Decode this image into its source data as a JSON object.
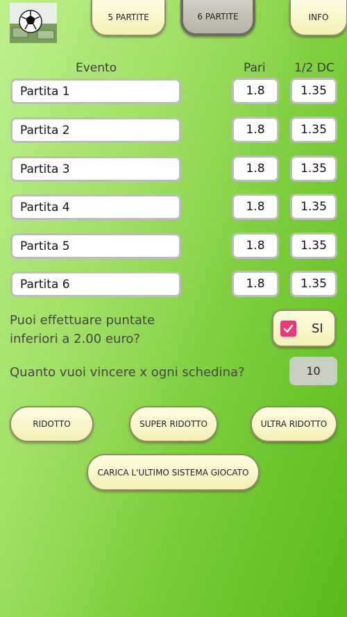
{
  "tabs": [
    {
      "label": "5 PARTITE",
      "active": false
    },
    {
      "label": "6 PARTITE",
      "active": true
    },
    {
      "label": "INFO",
      "active": false
    }
  ],
  "columns": {
    "event": "Evento",
    "pari": "Pari",
    "dc": "1/2 DC"
  },
  "matches": [
    {
      "name": "Partita 1",
      "pari": "1.8",
      "dc": "1.35"
    },
    {
      "name": "Partita 2",
      "pari": "1.8",
      "dc": "1.35"
    },
    {
      "name": "Partita 3",
      "pari": "1.8",
      "dc": "1.35"
    },
    {
      "name": "Partita 4",
      "pari": "1.8",
      "dc": "1.35"
    },
    {
      "name": "Partita 5",
      "pari": "1.8",
      "dc": "1.35"
    },
    {
      "name": "Partita 6",
      "pari": "1.8",
      "dc": "1.35"
    }
  ],
  "low_bet": {
    "question_line1": "Puoi effettuare puntate",
    "question_line2": "inferiori a 2.00 euro?",
    "checkbox_label": "SI",
    "checked": true
  },
  "win_target": {
    "question": "Quanto vuoi vincere x ogni schedina?",
    "value": "10"
  },
  "buttons": {
    "ridotto": "RIDOTTO",
    "super_ridotto": "SUPER RIDOTTO",
    "ultra_ridotto": "ULTRA RIDOTTO",
    "carica": "CARICA L'ULTIMO SISTEMA GIOCATO"
  },
  "colors": {
    "checkbox": "#e93a77",
    "button_bg": "#f7f3c4",
    "background_end": "#5bb81d"
  }
}
